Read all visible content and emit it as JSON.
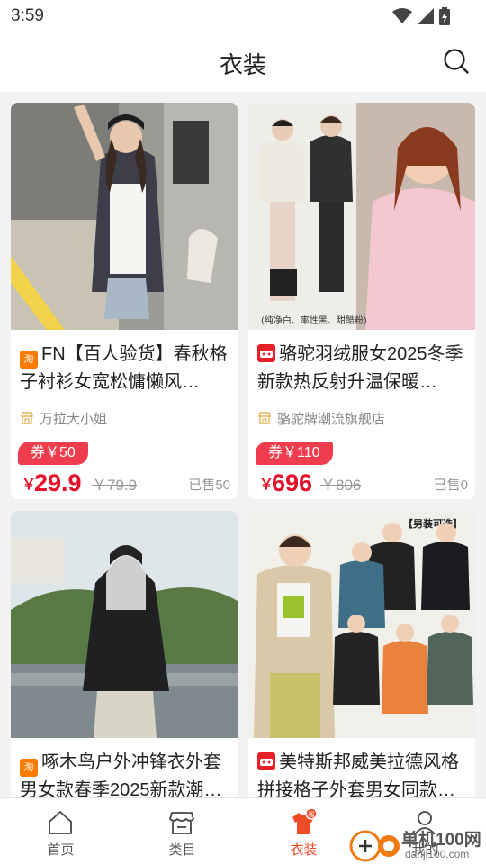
{
  "status_bar": {
    "time": "3:59"
  },
  "header": {
    "title": "衣装"
  },
  "products": [
    {
      "badge": "淘",
      "badge_type": "taobao",
      "title": "FN【百人验货】春秋格子衬衫女宽松慵懒风…",
      "shop": "万拉大小姐",
      "coupon": "券￥50",
      "currency": "￥",
      "price": "29.9",
      "orig_price": "￥79.9",
      "sold": "已售50"
    },
    {
      "badge": "天猫",
      "badge_type": "tmall",
      "title": "骆驼羽绒服女2025冬季新款热反射升温保暖…",
      "shop": "骆驼牌潮流旗舰店",
      "coupon": "券￥110",
      "currency": "￥",
      "price": "696",
      "orig_price": "￥806",
      "sold": "已售0",
      "image_caption": "(纯净白、率性黑、甜酷粉)"
    },
    {
      "badge": "淘",
      "badge_type": "taobao",
      "title": "啄木鸟户外冲锋衣外套男女款春季2025新款潮…"
    },
    {
      "badge": "天猫",
      "badge_type": "tmall",
      "title": "美特斯邦威美拉德风格拼接格子外套男女同款…",
      "image_caption": "【男装可选】"
    }
  ],
  "tabs": [
    {
      "label": "首页",
      "icon": "home-icon"
    },
    {
      "label": "类目",
      "icon": "category-icon"
    },
    {
      "label": "衣装",
      "icon": "clothing-icon",
      "active": true,
      "bubble": "省"
    },
    {
      "label": "我的",
      "icon": "profile-icon"
    }
  ],
  "watermark": {
    "line1": "单机100网",
    "line2": "danji100.com"
  },
  "colors": {
    "accent": "#ef4b26",
    "price": "#e5112a",
    "coupon": "#f03d4e",
    "taobao": "#ff7a00",
    "tmall": "#e8202a"
  }
}
